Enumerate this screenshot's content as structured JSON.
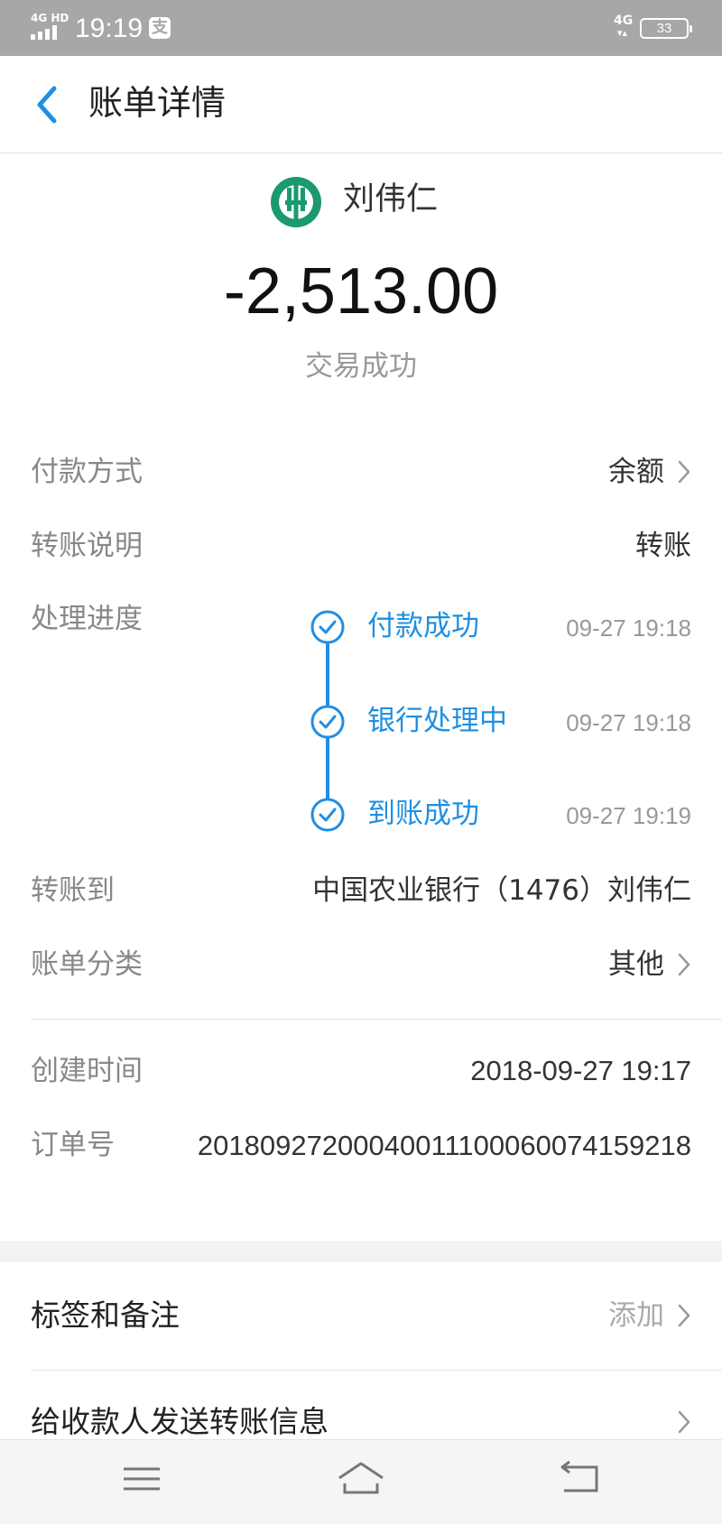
{
  "status_bar": {
    "network": "4G HD",
    "time": "19:19",
    "pay_icon_label": "支",
    "mobile_data": "4G",
    "data_arrows": "▾▴",
    "battery": "33"
  },
  "header": {
    "title": "账单详情",
    "back_icon": "chevron-left-icon"
  },
  "summary": {
    "payee_name": "刘伟仁",
    "amount": "-2,513.00",
    "status": "交易成功"
  },
  "details": {
    "payment_method_label": "付款方式",
    "payment_method_value": "余额",
    "transfer_note_label": "转账说明",
    "transfer_note_value": "转账",
    "progress_label": "处理进度",
    "progress_steps": [
      {
        "label": "付款成功",
        "time": "09-27 19:18"
      },
      {
        "label": "银行处理中",
        "time": "09-27 19:18"
      },
      {
        "label": "到账成功",
        "time": "09-27 19:19"
      }
    ],
    "transfer_to_label": "转账到",
    "transfer_to_value": "中国农业银行（1476）刘伟仁",
    "category_label": "账单分类",
    "category_value": "其他",
    "created_label": "创建时间",
    "created_value": "2018-09-27 19:17",
    "order_label": "订单号",
    "order_value": "20180927200040011100060074159218"
  },
  "actions": {
    "tags_label": "标签和备注",
    "tags_hint": "添加",
    "send_info_label": "给收款人发送转账信息"
  },
  "colors": {
    "accent": "#1f8fe1",
    "bank_green": "#1a9a6e",
    "status_bar": "#a7a7a7"
  }
}
